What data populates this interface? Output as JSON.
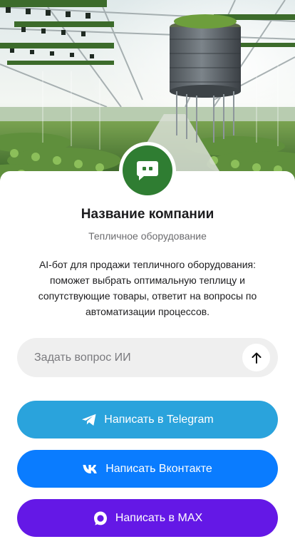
{
  "profile": {
    "name": "Название компании",
    "subtitle": "Тепличное оборудование",
    "description": "AI-бот для продажи тепличного оборудования: поможет выбрать оптимальную теплицу и сопутствующие товары, ответит на вопросы по автоматизации процессов."
  },
  "ask": {
    "placeholder": "Задать вопрос ИИ"
  },
  "buttons": {
    "telegram": "Написать в Telegram",
    "vk": "Написать Вконтакте",
    "max": "Написать в MAX"
  },
  "icons": {
    "avatar": "chat-bot-icon",
    "send": "arrow-up-icon",
    "telegram": "telegram-icon",
    "vk": "vk-icon",
    "max": "max-icon"
  },
  "colors": {
    "avatar_bg": "#2f7d32",
    "telegram": "#2aa3dc",
    "vk": "#0a7cff",
    "max": "#6418e6",
    "ask_bg": "#efefef"
  }
}
